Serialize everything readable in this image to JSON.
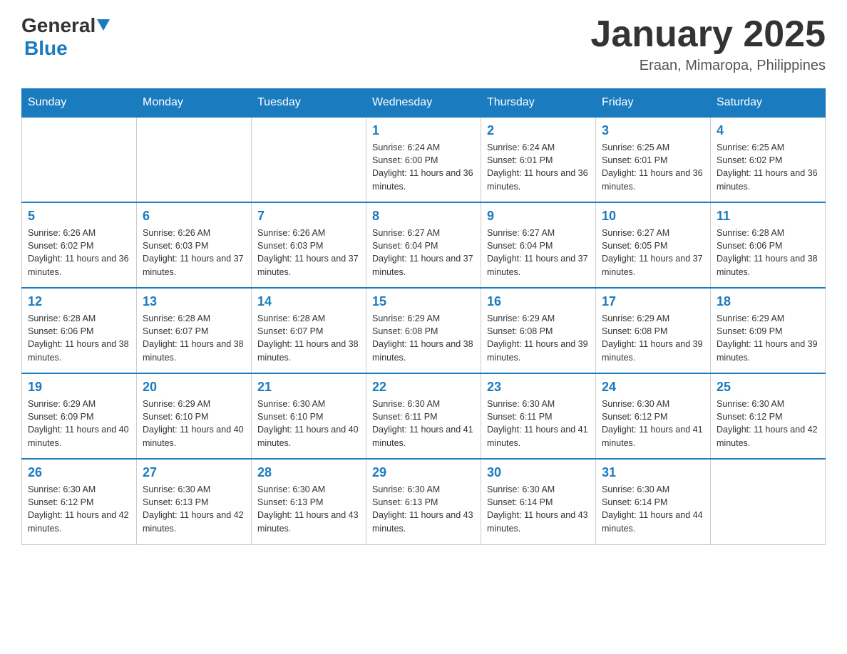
{
  "logo": {
    "general": "General",
    "blue": "Blue"
  },
  "title": "January 2025",
  "subtitle": "Eraan, Mimaropa, Philippines",
  "days_of_week": [
    "Sunday",
    "Monday",
    "Tuesday",
    "Wednesday",
    "Thursday",
    "Friday",
    "Saturday"
  ],
  "weeks": [
    [
      null,
      null,
      null,
      {
        "day": "1",
        "sunrise": "6:24 AM",
        "sunset": "6:00 PM",
        "daylight": "11 hours and 36 minutes."
      },
      {
        "day": "2",
        "sunrise": "6:24 AM",
        "sunset": "6:01 PM",
        "daylight": "11 hours and 36 minutes."
      },
      {
        "day": "3",
        "sunrise": "6:25 AM",
        "sunset": "6:01 PM",
        "daylight": "11 hours and 36 minutes."
      },
      {
        "day": "4",
        "sunrise": "6:25 AM",
        "sunset": "6:02 PM",
        "daylight": "11 hours and 36 minutes."
      }
    ],
    [
      {
        "day": "5",
        "sunrise": "6:26 AM",
        "sunset": "6:02 PM",
        "daylight": "11 hours and 36 minutes."
      },
      {
        "day": "6",
        "sunrise": "6:26 AM",
        "sunset": "6:03 PM",
        "daylight": "11 hours and 37 minutes."
      },
      {
        "day": "7",
        "sunrise": "6:26 AM",
        "sunset": "6:03 PM",
        "daylight": "11 hours and 37 minutes."
      },
      {
        "day": "8",
        "sunrise": "6:27 AM",
        "sunset": "6:04 PM",
        "daylight": "11 hours and 37 minutes."
      },
      {
        "day": "9",
        "sunrise": "6:27 AM",
        "sunset": "6:04 PM",
        "daylight": "11 hours and 37 minutes."
      },
      {
        "day": "10",
        "sunrise": "6:27 AM",
        "sunset": "6:05 PM",
        "daylight": "11 hours and 37 minutes."
      },
      {
        "day": "11",
        "sunrise": "6:28 AM",
        "sunset": "6:06 PM",
        "daylight": "11 hours and 38 minutes."
      }
    ],
    [
      {
        "day": "12",
        "sunrise": "6:28 AM",
        "sunset": "6:06 PM",
        "daylight": "11 hours and 38 minutes."
      },
      {
        "day": "13",
        "sunrise": "6:28 AM",
        "sunset": "6:07 PM",
        "daylight": "11 hours and 38 minutes."
      },
      {
        "day": "14",
        "sunrise": "6:28 AM",
        "sunset": "6:07 PM",
        "daylight": "11 hours and 38 minutes."
      },
      {
        "day": "15",
        "sunrise": "6:29 AM",
        "sunset": "6:08 PM",
        "daylight": "11 hours and 38 minutes."
      },
      {
        "day": "16",
        "sunrise": "6:29 AM",
        "sunset": "6:08 PM",
        "daylight": "11 hours and 39 minutes."
      },
      {
        "day": "17",
        "sunrise": "6:29 AM",
        "sunset": "6:08 PM",
        "daylight": "11 hours and 39 minutes."
      },
      {
        "day": "18",
        "sunrise": "6:29 AM",
        "sunset": "6:09 PM",
        "daylight": "11 hours and 39 minutes."
      }
    ],
    [
      {
        "day": "19",
        "sunrise": "6:29 AM",
        "sunset": "6:09 PM",
        "daylight": "11 hours and 40 minutes."
      },
      {
        "day": "20",
        "sunrise": "6:29 AM",
        "sunset": "6:10 PM",
        "daylight": "11 hours and 40 minutes."
      },
      {
        "day": "21",
        "sunrise": "6:30 AM",
        "sunset": "6:10 PM",
        "daylight": "11 hours and 40 minutes."
      },
      {
        "day": "22",
        "sunrise": "6:30 AM",
        "sunset": "6:11 PM",
        "daylight": "11 hours and 41 minutes."
      },
      {
        "day": "23",
        "sunrise": "6:30 AM",
        "sunset": "6:11 PM",
        "daylight": "11 hours and 41 minutes."
      },
      {
        "day": "24",
        "sunrise": "6:30 AM",
        "sunset": "6:12 PM",
        "daylight": "11 hours and 41 minutes."
      },
      {
        "day": "25",
        "sunrise": "6:30 AM",
        "sunset": "6:12 PM",
        "daylight": "11 hours and 42 minutes."
      }
    ],
    [
      {
        "day": "26",
        "sunrise": "6:30 AM",
        "sunset": "6:12 PM",
        "daylight": "11 hours and 42 minutes."
      },
      {
        "day": "27",
        "sunrise": "6:30 AM",
        "sunset": "6:13 PM",
        "daylight": "11 hours and 42 minutes."
      },
      {
        "day": "28",
        "sunrise": "6:30 AM",
        "sunset": "6:13 PM",
        "daylight": "11 hours and 43 minutes."
      },
      {
        "day": "29",
        "sunrise": "6:30 AM",
        "sunset": "6:13 PM",
        "daylight": "11 hours and 43 minutes."
      },
      {
        "day": "30",
        "sunrise": "6:30 AM",
        "sunset": "6:14 PM",
        "daylight": "11 hours and 43 minutes."
      },
      {
        "day": "31",
        "sunrise": "6:30 AM",
        "sunset": "6:14 PM",
        "daylight": "11 hours and 44 minutes."
      },
      null
    ]
  ]
}
